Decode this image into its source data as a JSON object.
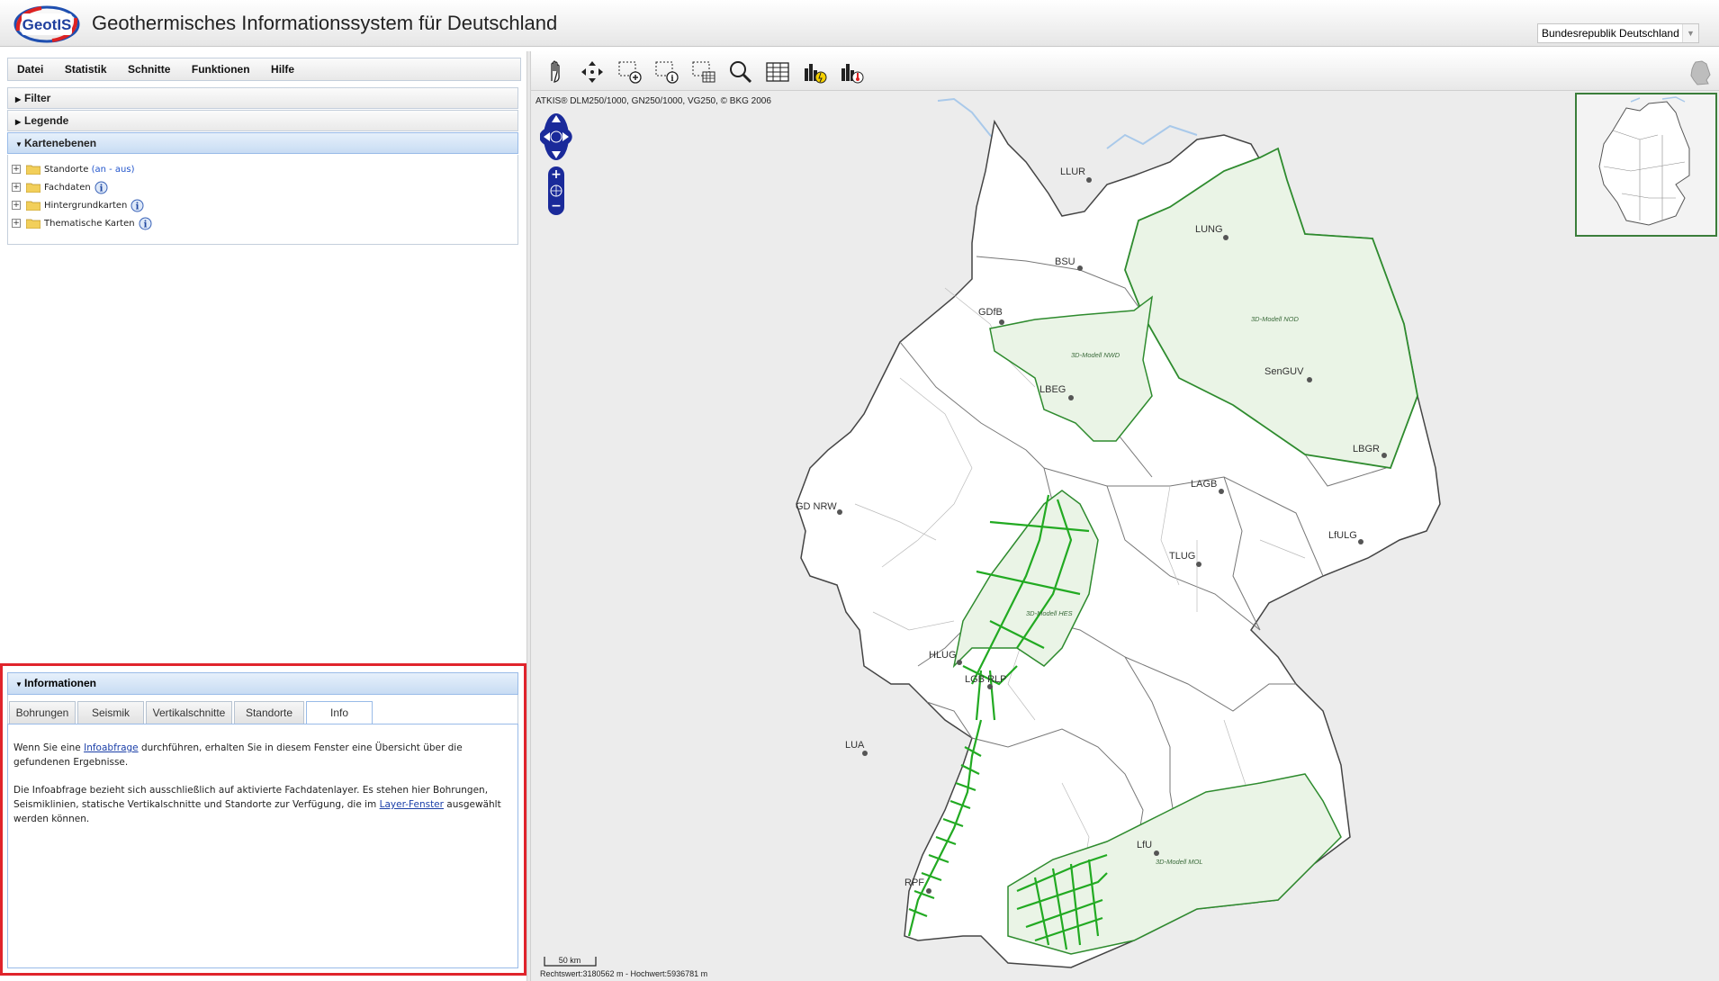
{
  "header": {
    "logo_text": "GeotIS",
    "title": "Geothermisches Informationssystem für Deutschland",
    "region_select": "Bundesrepublik Deutschland"
  },
  "menu": {
    "items": [
      "Datei",
      "Statistik",
      "Schnitte",
      "Funktionen",
      "Hilfe"
    ]
  },
  "accordion": {
    "filter": "Filter",
    "legende": "Legende",
    "kartenebenen": "Kartenebenen"
  },
  "tree": {
    "standorte": "Standorte",
    "standorte_toggle": "(an - aus)",
    "fachdaten": "Fachdaten",
    "hintergrundkarten": "Hintergrundkarten",
    "thematische_karten": "Thematische Karten"
  },
  "info_panel": {
    "title": "Informationen",
    "tabs": [
      "Bohrungen",
      "Seismik",
      "Vertikalschnitte",
      "Standorte",
      "Info"
    ],
    "active_tab": "Info",
    "p1_before": "Wenn Sie eine ",
    "p1_link": "Infoabfrage",
    "p1_after": " durchführen, erhalten Sie in diesem Fenster eine Übersicht über die gefundenen Ergebnisse.",
    "p2_before": "Die Infoabfrage bezieht sich ausschließlich auf aktivierte Fachdatenlayer. Es stehen hier Bohrungen, Seismiklinien, statische Vertikalschnitte und Standorte zur Verfügung, die im ",
    "p2_link": "Layer-Fenster",
    "p2_after": " ausgewählt werden können."
  },
  "map": {
    "copyright": "ATKIS® DLM250/1000, GN250/1000, VG250, © BKG 2006",
    "scale_label": "50 km",
    "coords": "Rechtswert:3180562 m - Hochwert:5936781 m",
    "locations": [
      "LLUR",
      "LUNG",
      "BSU",
      "GDfB",
      "SenGUV",
      "LBEG",
      "LBGR",
      "LAGB",
      "GD NRW",
      "LfULG",
      "TLUG",
      "HLUG",
      "LGB RLP",
      "LUA",
      "LfU",
      "RPF"
    ],
    "models": [
      "3D-Modell NOD",
      "3D-Modell NWD",
      "3D-Modell HES",
      "3D-Modell MOL"
    ]
  },
  "colors": {
    "highlight_frame": "#e0242c",
    "model_fill": "#eaf4e6",
    "model_stroke": "#2e8b2e",
    "accent_blue": "#99bbe8",
    "nav_blue": "#1a2a9a"
  }
}
